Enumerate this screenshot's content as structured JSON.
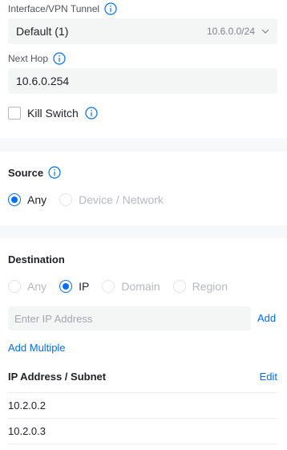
{
  "interface": {
    "label": "Interface/VPN Tunnel",
    "selected": "Default (1)",
    "subnet": "10.6.0.0/24"
  },
  "next_hop": {
    "label": "Next Hop",
    "value": "10.6.0.254"
  },
  "kill_switch": {
    "label": "Kill Switch",
    "checked": false
  },
  "source": {
    "title": "Source",
    "options": [
      "Any",
      "Device / Network"
    ],
    "selected": "Any"
  },
  "destination": {
    "title": "Destination",
    "options": [
      "Any",
      "IP",
      "Domain",
      "Region"
    ],
    "selected": "IP",
    "ip_placeholder": "Enter IP Address",
    "add_label": "Add",
    "add_multiple_label": "Add Multiple"
  },
  "ip_table": {
    "header": "IP Address / Subnet",
    "edit_label": "Edit",
    "rows": [
      "10.2.0.2",
      "10.2.0.3"
    ]
  },
  "colors": {
    "accent": "#006fff",
    "band": "#f7f8f9",
    "field_bg": "#f4f5f5"
  }
}
